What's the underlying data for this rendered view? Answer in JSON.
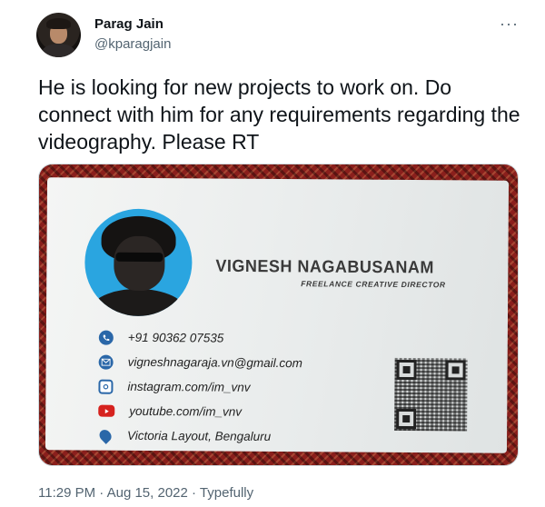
{
  "author": {
    "name": "Parag Jain",
    "handle": "@kparagjain"
  },
  "more_label": "···",
  "tweet_text": "He is looking for new projects to work on. Do connect with him for any requirements regarding the videography. Please RT",
  "card": {
    "name": "VIGNESH NAGABUSANAM",
    "title": "FREELANCE CREATIVE DIRECTOR",
    "contacts": [
      {
        "icon": "whatsapp-icon",
        "text": "+91 90362 07535"
      },
      {
        "icon": "mail-icon",
        "text": "vigneshnagaraja.vn@gmail.com"
      },
      {
        "icon": "instagram-icon",
        "text": "instagram.com/im_vnv"
      },
      {
        "icon": "youtube-icon",
        "text": "youtube.com/im_vnv"
      },
      {
        "icon": "location-pin-icon",
        "text": "Victoria Layout, Bengaluru"
      }
    ]
  },
  "meta": {
    "time": "11:29 PM",
    "sep1": " · ",
    "date": "Aug 15, 2022",
    "sep2": " · ",
    "app": "Typefully"
  },
  "colors": {
    "text": "#0f1419",
    "secondary": "#536471",
    "card_icon": "#2a67a8",
    "youtube_red": "#d6221e"
  }
}
